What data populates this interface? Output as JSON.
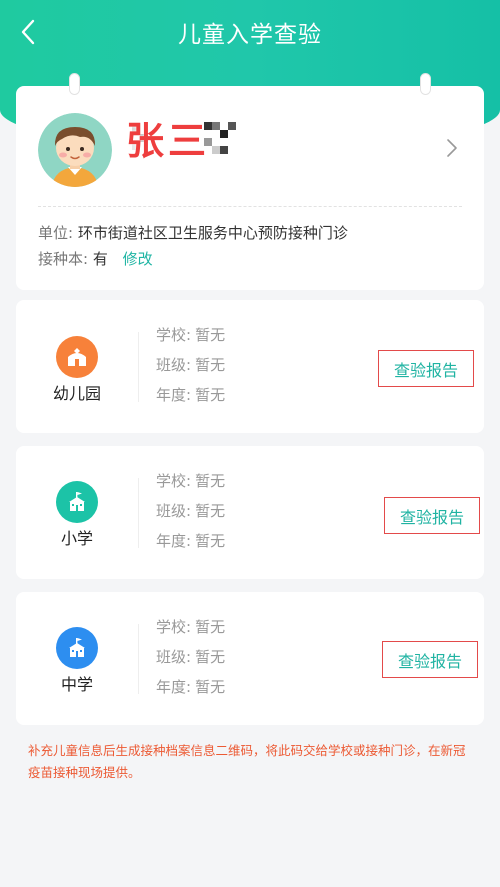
{
  "nav": {
    "title": "儿童入学查验"
  },
  "profile": {
    "name": "张三",
    "unit_label": "单位:",
    "unit_value": "环市街道社区卫生服务中心预防接种门诊",
    "book_label": "接种本:",
    "book_value": "有",
    "edit_label": "修改"
  },
  "schools": [
    {
      "name": "幼儿园",
      "icon": "kindergarten-icon",
      "color": "#f7813a",
      "rows": [
        {
          "label": "学校:",
          "value": "暂无"
        },
        {
          "label": "班级:",
          "value": "暂无"
        },
        {
          "label": "年度:",
          "value": "暂无"
        }
      ],
      "button": "查验报告"
    },
    {
      "name": "小学",
      "icon": "primary-school-icon",
      "color": "#1cc3a7",
      "rows": [
        {
          "label": "学校:",
          "value": "暂无"
        },
        {
          "label": "班级:",
          "value": "暂无"
        },
        {
          "label": "年度:",
          "value": "暂无"
        }
      ],
      "button": "查验报告"
    },
    {
      "name": "中学",
      "icon": "middle-school-icon",
      "color": "#2d8ef0",
      "rows": [
        {
          "label": "学校:",
          "value": "暂无"
        },
        {
          "label": "班级:",
          "value": "暂无"
        },
        {
          "label": "年度:",
          "value": "暂无"
        }
      ],
      "button": "查验报告"
    }
  ],
  "note": "补充儿童信息后生成接种档案信息二维码，将此码交给学校或接种门诊，在新冠疫苗接种现场提供。",
  "colors": {
    "accent": "#20c7aa",
    "link": "#20b5a4",
    "warning": "#ec5a34",
    "highlight_border": "#e34a4a"
  }
}
